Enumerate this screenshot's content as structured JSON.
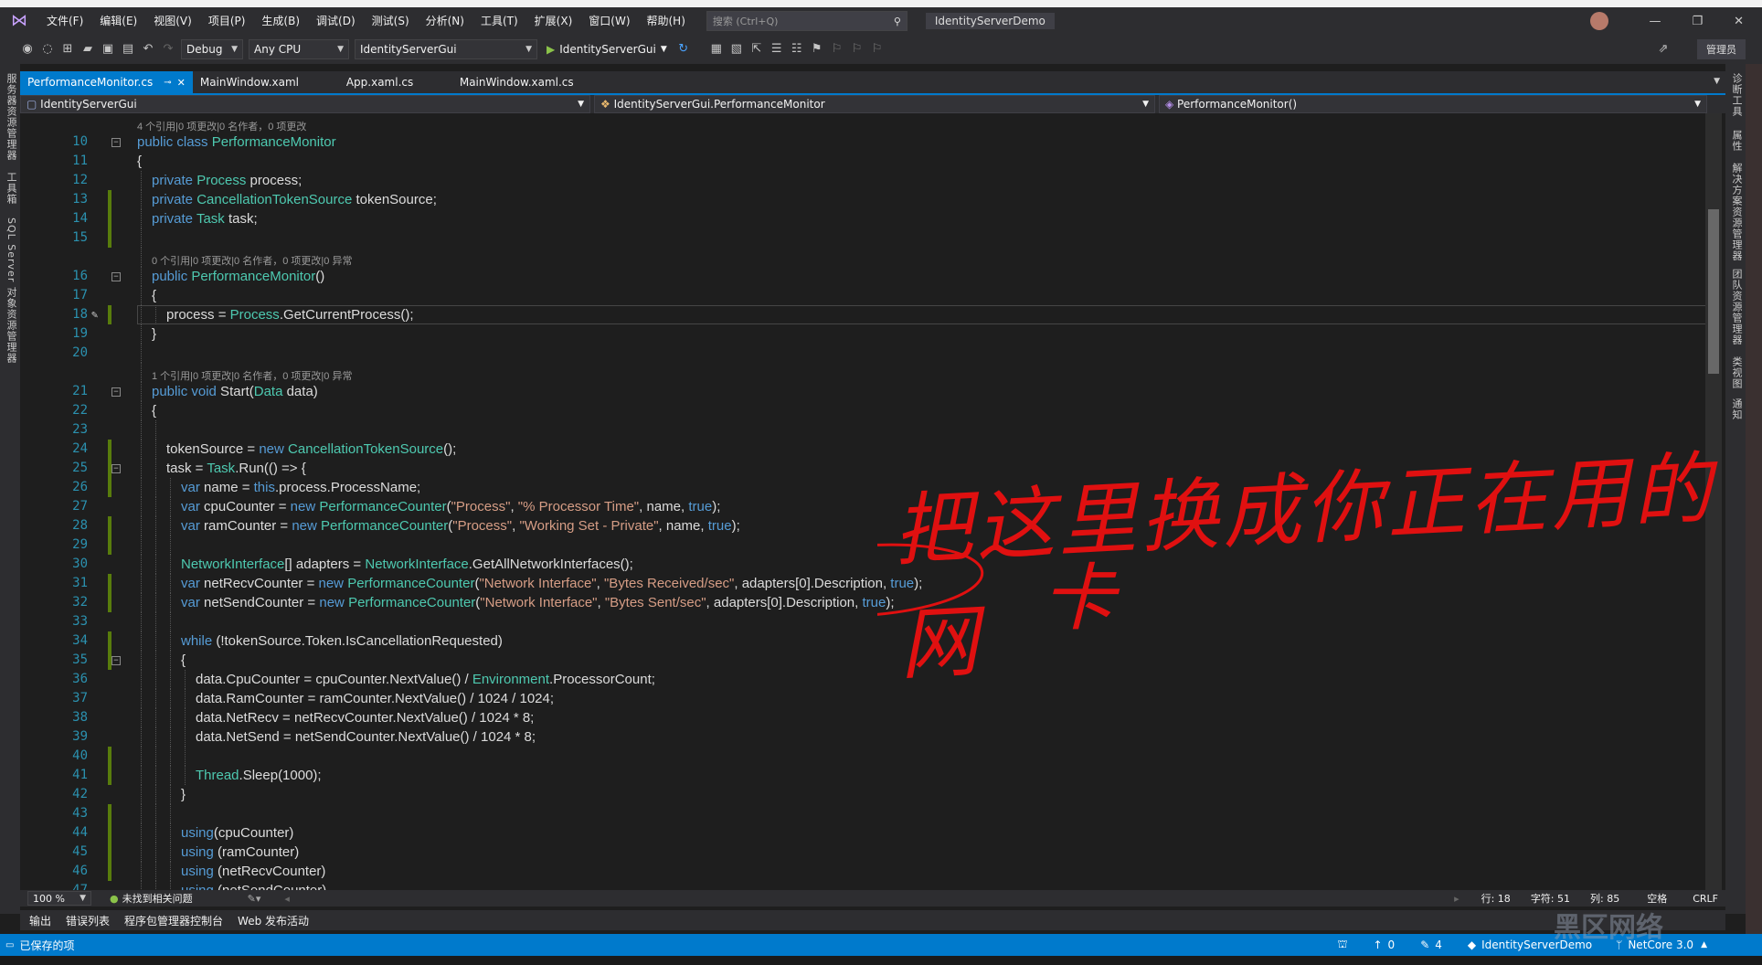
{
  "menu": {
    "items": [
      "文件(F)",
      "编辑(E)",
      "视图(V)",
      "项目(P)",
      "生成(B)",
      "调试(D)",
      "测试(S)",
      "分析(N)",
      "工具(T)",
      "扩展(X)",
      "窗口(W)",
      "帮助(H)"
    ],
    "search_placeholder": "搜索 (Ctrl+Q)",
    "solution_title": "IdentityServerDemo"
  },
  "toolbar": {
    "config": "Debug",
    "platform": "Any CPU",
    "project": "IdentityServerGui",
    "run_target": "IdentityServerGui",
    "admin_label": "管理员"
  },
  "left_panels": [
    "服务器资源管理器",
    "工具箱",
    "SQL Server 对象资源管理器"
  ],
  "right_panels": [
    "诊断工具",
    "属性",
    "解决方案资源管理器",
    "团队资源管理器",
    "类视图",
    "通知"
  ],
  "tabs": [
    {
      "label": "PerformanceMonitor.cs",
      "active": true
    },
    {
      "label": "MainWindow.xaml",
      "active": false
    },
    {
      "label": "App.xaml.cs",
      "active": false
    },
    {
      "label": "MainWindow.xaml.cs",
      "active": false
    }
  ],
  "nav": {
    "project": "IdentityServerGui",
    "type": "IdentityServerGui.PerformanceMonitor",
    "member": "PerformanceMonitor()"
  },
  "code_lines": [
    {
      "n": "",
      "lens": "4 个引用|0 项更改|0 名作者，0 项更改",
      "indent": 0
    },
    {
      "n": "10",
      "html": "<span class='kw'>public class</span> <span class='ty'>PerformanceMonitor</span>",
      "indent": 0
    },
    {
      "n": "11",
      "html": "{",
      "indent": 0
    },
    {
      "n": "12",
      "html": "<span class='kw'>private</span> <span class='ty'>Process</span> process;",
      "indent": 1
    },
    {
      "n": "13",
      "html": "<span class='kw'>private</span> <span class='ty'>CancellationTokenSource</span> tokenSource;",
      "indent": 1
    },
    {
      "n": "14",
      "html": "<span class='kw'>private</span> <span class='ty'>Task</span> task;",
      "indent": 1
    },
    {
      "n": "15",
      "html": "",
      "indent": 1
    },
    {
      "n": "",
      "lens": "0 个引用|0 项更改|0 名作者，0 项更改|0 异常",
      "indent": 1
    },
    {
      "n": "16",
      "html": "<span class='kw'>public</span> <span class='ty'>PerformanceMonitor</span>()",
      "indent": 1
    },
    {
      "n": "17",
      "html": "{",
      "indent": 1
    },
    {
      "n": "18",
      "html": "process = <span class='ty'>Process</span>.GetCurrentProcess();",
      "indent": 2
    },
    {
      "n": "19",
      "html": "}",
      "indent": 1
    },
    {
      "n": "20",
      "html": "",
      "indent": 1
    },
    {
      "n": "",
      "lens": "1 个引用|0 项更改|0 名作者，0 项更改|0 异常",
      "indent": 1
    },
    {
      "n": "21",
      "html": "<span class='kw'>public void</span> Start(<span class='ty'>Data</span> data)",
      "indent": 1
    },
    {
      "n": "22",
      "html": "{",
      "indent": 1
    },
    {
      "n": "23",
      "html": "",
      "indent": 2
    },
    {
      "n": "24",
      "html": "tokenSource = <span class='kw'>new</span> <span class='ty'>CancellationTokenSource</span>();",
      "indent": 2
    },
    {
      "n": "25",
      "html": "task = <span class='ty'>Task</span>.Run(() =&gt; {",
      "indent": 2
    },
    {
      "n": "26",
      "html": "<span class='kw'>var</span> name = <span class='kw'>this</span>.process.ProcessName;",
      "indent": 3
    },
    {
      "n": "27",
      "html": "<span class='kw'>var</span> cpuCounter = <span class='kw'>new</span> <span class='ty'>PerformanceCounter</span>(<span class='st'>\"Process\"</span>, <span class='st'>\"% Processor Time\"</span>, name, <span class='kw'>true</span>);",
      "indent": 3
    },
    {
      "n": "28",
      "html": "<span class='kw'>var</span> ramCounter = <span class='kw'>new</span> <span class='ty'>PerformanceCounter</span>(<span class='st'>\"Process\"</span>, <span class='st'>\"Working Set - Private\"</span>, name, <span class='kw'>true</span>);",
      "indent": 3
    },
    {
      "n": "29",
      "html": "",
      "indent": 3
    },
    {
      "n": "30",
      "html": "<span class='ty'>NetworkInterface</span>[] adapters = <span class='ty'>NetworkInterface</span>.GetAllNetworkInterfaces();",
      "indent": 3
    },
    {
      "n": "31",
      "html": "<span class='kw'>var</span> netRecvCounter = <span class='kw'>new</span> <span class='ty'>PerformanceCounter</span>(<span class='st'>\"Network Interface\"</span>, <span class='st'>\"Bytes Received/sec\"</span>, adapters[0].Description, <span class='kw'>true</span>);",
      "indent": 3
    },
    {
      "n": "32",
      "html": "<span class='kw'>var</span> netSendCounter = <span class='kw'>new</span> <span class='ty'>PerformanceCounter</span>(<span class='st'>\"Network Interface\"</span>, <span class='st'>\"Bytes Sent/sec\"</span>, adapters[0].Description, <span class='kw'>true</span>);",
      "indent": 3
    },
    {
      "n": "33",
      "html": "",
      "indent": 3
    },
    {
      "n": "34",
      "html": "<span class='kw'>while</span> (!tokenSource.Token.IsCancellationRequested)",
      "indent": 3
    },
    {
      "n": "35",
      "html": "{",
      "indent": 3
    },
    {
      "n": "36",
      "html": "data.CpuCounter = cpuCounter.NextValue() / <span class='ty'>Environment</span>.ProcessorCount;",
      "indent": 4
    },
    {
      "n": "37",
      "html": "data.RamCounter = ramCounter.NextValue() / 1024 / 1024;",
      "indent": 4
    },
    {
      "n": "38",
      "html": "data.NetRecv = netRecvCounter.NextValue() / 1024 * 8;",
      "indent": 4
    },
    {
      "n": "39",
      "html": "data.NetSend = netSendCounter.NextValue() / 1024 * 8;",
      "indent": 4
    },
    {
      "n": "40",
      "html": "",
      "indent": 4
    },
    {
      "n": "41",
      "html": "<span class='ty'>Thread</span>.Sleep(1000);",
      "indent": 4
    },
    {
      "n": "42",
      "html": "}",
      "indent": 3
    },
    {
      "n": "43",
      "html": "",
      "indent": 3
    },
    {
      "n": "44",
      "html": "<span class='kw'>using</span>(cpuCounter)",
      "indent": 3
    },
    {
      "n": "45",
      "html": "<span class='kw'>using</span> (ramCounter)",
      "indent": 3
    },
    {
      "n": "46",
      "html": "<span class='kw'>using</span> (netRecvCounter)",
      "indent": 3
    },
    {
      "n": "47",
      "html": "<span class='kw'>using</span> (netSendCounter)",
      "indent": 3
    }
  ],
  "annotation": {
    "line1": "把这里换成你正在用的网",
    "line2": "卡"
  },
  "editor_status": {
    "zoom": "100 %",
    "issues": "未找到相关问题",
    "row": "行: 18",
    "char": "字符: 51",
    "col": "列: 85",
    "whitespace": "空格",
    "eol": "CRLF"
  },
  "bottom_tabs": [
    "输出",
    "错误列表",
    "程序包管理器控制台",
    "Web 发布活动"
  ],
  "statusbar": {
    "saved": "已保存的项",
    "up": "0",
    "edits": "4",
    "repo": "IdentityServerDemo",
    "branch": "NetCore 3.0"
  },
  "watermark": "黑区网络"
}
